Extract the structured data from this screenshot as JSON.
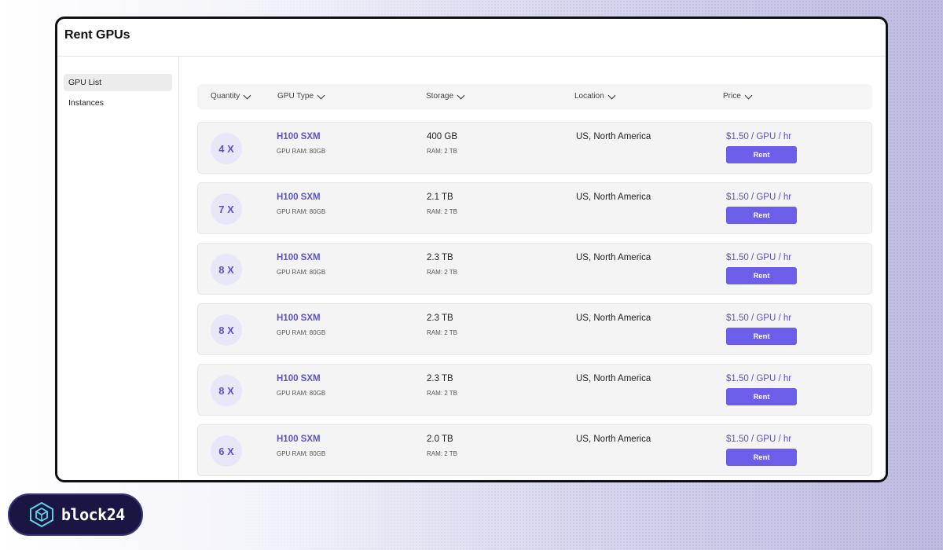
{
  "app": {
    "title": "Rent GPUs"
  },
  "sidebar": {
    "items": [
      {
        "label": "GPU List",
        "active": true
      },
      {
        "label": "Instances",
        "active": false
      }
    ]
  },
  "table": {
    "headers": {
      "quantity": "Quantity",
      "gpu_type": "GPU Type",
      "storage": "Storage",
      "location": "Location",
      "price": "Price"
    },
    "rows": [
      {
        "quantity": "4 X",
        "gpu": "H100 SXM",
        "gpu_ram": "GPU RAM: 80GB",
        "storage": "400 GB",
        "ram": "RAM: 2 TB",
        "location": "US, North America",
        "price": "$1.50 / GPU / hr",
        "action": "Rent"
      },
      {
        "quantity": "7 X",
        "gpu": "H100 SXM",
        "gpu_ram": "GPU RAM: 80GB",
        "storage": "2.1 TB",
        "ram": "RAM: 2 TB",
        "location": "US, North America",
        "price": "$1.50 / GPU / hr",
        "action": "Rent"
      },
      {
        "quantity": "8 X",
        "gpu": "H100 SXM",
        "gpu_ram": "GPU RAM: 80GB",
        "storage": "2.3 TB",
        "ram": "RAM: 2 TB",
        "location": "US, North America",
        "price": "$1.50 / GPU / hr",
        "action": "Rent"
      },
      {
        "quantity": "8 X",
        "gpu": "H100 SXM",
        "gpu_ram": "GPU RAM: 80GB",
        "storage": "2.3 TB",
        "ram": "RAM: 2 TB",
        "location": "US, North America",
        "price": "$1.50 / GPU / hr",
        "action": "Rent"
      },
      {
        "quantity": "8 X",
        "gpu": "H100 SXM",
        "gpu_ram": "GPU RAM: 80GB",
        "storage": "2.3 TB",
        "ram": "RAM: 2 TB",
        "location": "US, North America",
        "price": "$1.50 / GPU / hr",
        "action": "Rent"
      },
      {
        "quantity": "6 X",
        "gpu": "H100 SXM",
        "gpu_ram": "GPU RAM: 80GB",
        "storage": "2.0 TB",
        "ram": "RAM: 2 TB",
        "location": "US, North America",
        "price": "$1.50 / GPU / hr",
        "action": "Rent"
      }
    ]
  },
  "brand": {
    "name": "block24",
    "icon": "cube-logo-icon"
  },
  "colors": {
    "accent": "#6c5ee8",
    "accent_text": "#5b53c9",
    "brand_bg": "#1a1543"
  }
}
